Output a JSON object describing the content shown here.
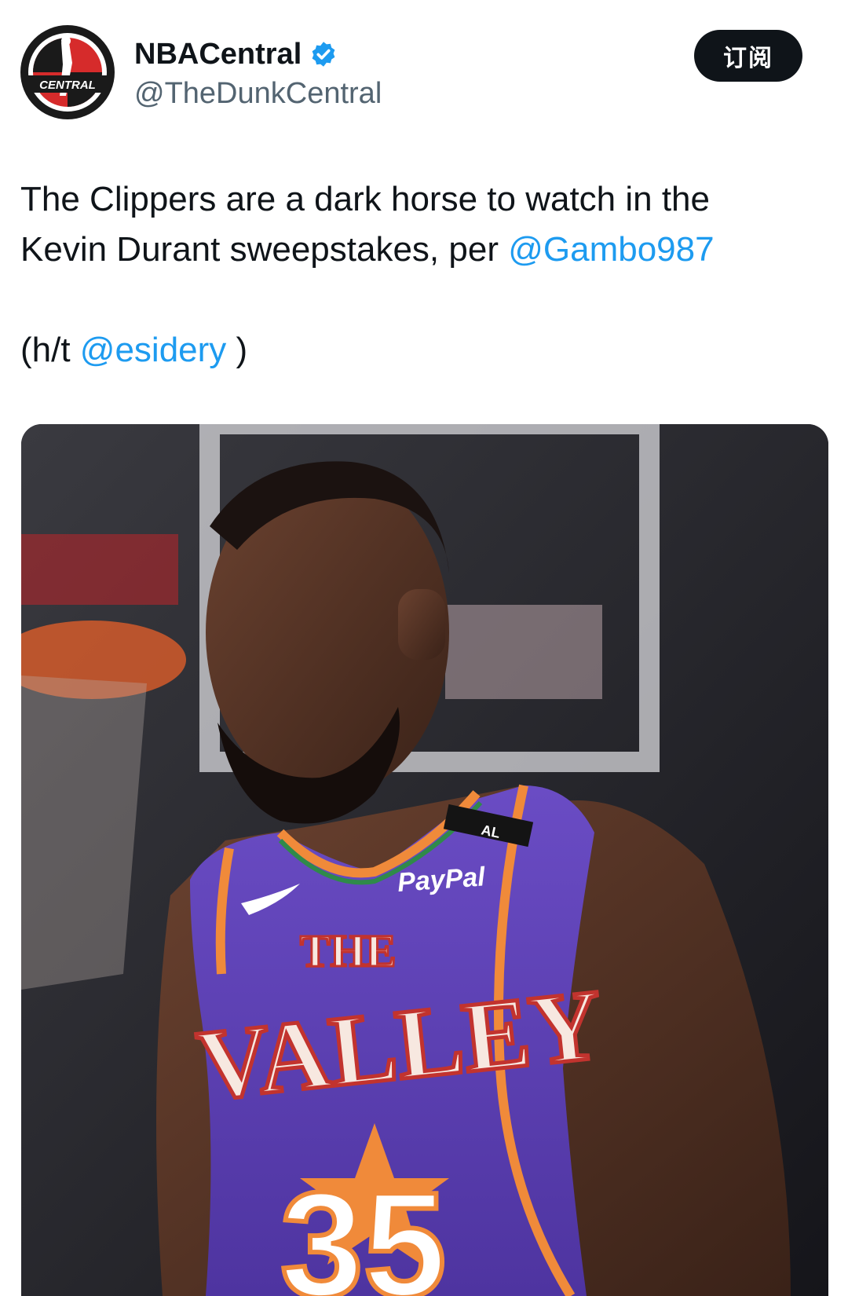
{
  "account": {
    "display_name": "NBACentral",
    "handle": "@TheDunkCentral",
    "verified": true,
    "logo_text": "CENTRAL"
  },
  "subscribe_button": {
    "label": "订阅"
  },
  "tweet": {
    "line1": "The Clippers are a dark horse to watch in the",
    "line2_prefix": "Kevin Durant sweepstakes, per ",
    "mention1": "@Gambo987",
    "ht_prefix": "(h/t ",
    "mention2": "@esidery",
    "ht_suffix": " )"
  },
  "media": {
    "jersey_sponsor": "PayPal",
    "jersey_text_top": "THE",
    "jersey_text_main": "VALLEY",
    "jersey_number": "35",
    "strap_text": "AL"
  },
  "colors": {
    "mention": "#1d9bf0",
    "jersey_purple": "#5b3fb3",
    "jersey_orange": "#f08a3a",
    "subscribe_bg": "#0f1419"
  }
}
